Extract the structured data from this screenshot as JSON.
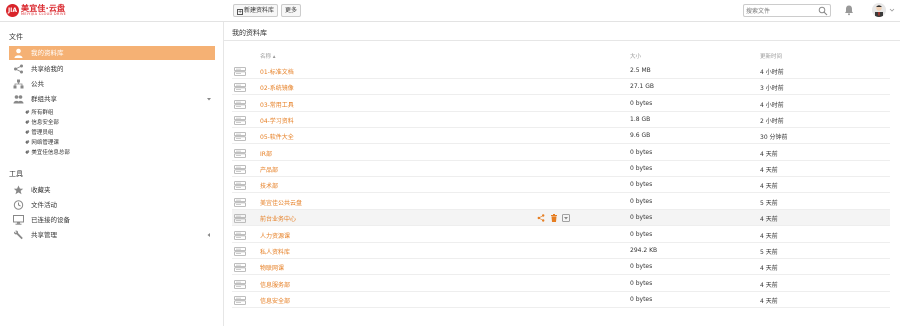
{
  "brand": {
    "badge": "JIA",
    "name": "美宜佳·云盘",
    "subtitle": "MEIYIJIA CLOUD DRIVE",
    "color": "#d9242a"
  },
  "toolbar": {
    "new_library_label": "新建资料库",
    "more_label": "更多",
    "search_placeholder": "搜索文件"
  },
  "sidebar": {
    "files_heading": "文件",
    "items": [
      {
        "label": "我的资料库",
        "icon": "user-icon",
        "active": true
      },
      {
        "label": "共享给我的",
        "icon": "share-icon"
      },
      {
        "label": "公共",
        "icon": "org-icon"
      },
      {
        "label": "群组共享",
        "icon": "group-icon"
      }
    ],
    "groups": [
      "所有群组",
      "信息安全部",
      "管理员组",
      "网络管理课",
      "美宜佳信息总部"
    ],
    "tools_heading": "工具",
    "tools": [
      {
        "label": "收藏夹",
        "icon": "star-icon"
      },
      {
        "label": "文件活动",
        "icon": "clock-icon"
      },
      {
        "label": "已连接的设备",
        "icon": "monitor-icon"
      },
      {
        "label": "共享管理",
        "icon": "wrench-icon"
      }
    ],
    "active_color": "#f5b174"
  },
  "main": {
    "title": "我的资料库",
    "columns": {
      "name": "名称 ▴",
      "size": "大小",
      "time": "更新时间"
    },
    "rows": [
      {
        "name": "01-标准文档",
        "size": "2.5 MB",
        "time": "4 小时前"
      },
      {
        "name": "02-系统镜像",
        "size": "27.1 GB",
        "time": "3 小时前"
      },
      {
        "name": "03-常用工具",
        "size": "0 bytes",
        "time": "4 小时前"
      },
      {
        "name": "04-学习资料",
        "size": "1.8 GB",
        "time": "2 小时前"
      },
      {
        "name": "05-软件大全",
        "size": "9.6 GB",
        "time": "30 分钟前"
      },
      {
        "name": "IR部",
        "size": "0 bytes",
        "time": "4 天前"
      },
      {
        "name": "产品部",
        "size": "0 bytes",
        "time": "4 天前"
      },
      {
        "name": "技术部",
        "size": "0 bytes",
        "time": "4 天前"
      },
      {
        "name": "美宜佳公共云盘",
        "size": "0 bytes",
        "time": "5 天前"
      },
      {
        "name": "前台业务中心",
        "size": "0 bytes",
        "time": "4 天前",
        "hover": true
      },
      {
        "name": "人力资源课",
        "size": "0 bytes",
        "time": "4 天前"
      },
      {
        "name": "私人资料库",
        "size": "294.2 KB",
        "time": "5 天前"
      },
      {
        "name": "物联网课",
        "size": "0 bytes",
        "time": "4 天前"
      },
      {
        "name": "信息服务部",
        "size": "0 bytes",
        "time": "4 天前"
      },
      {
        "name": "信息安全部",
        "size": "0 bytes",
        "time": "4 天前"
      }
    ],
    "link_color": "#e67e22"
  }
}
